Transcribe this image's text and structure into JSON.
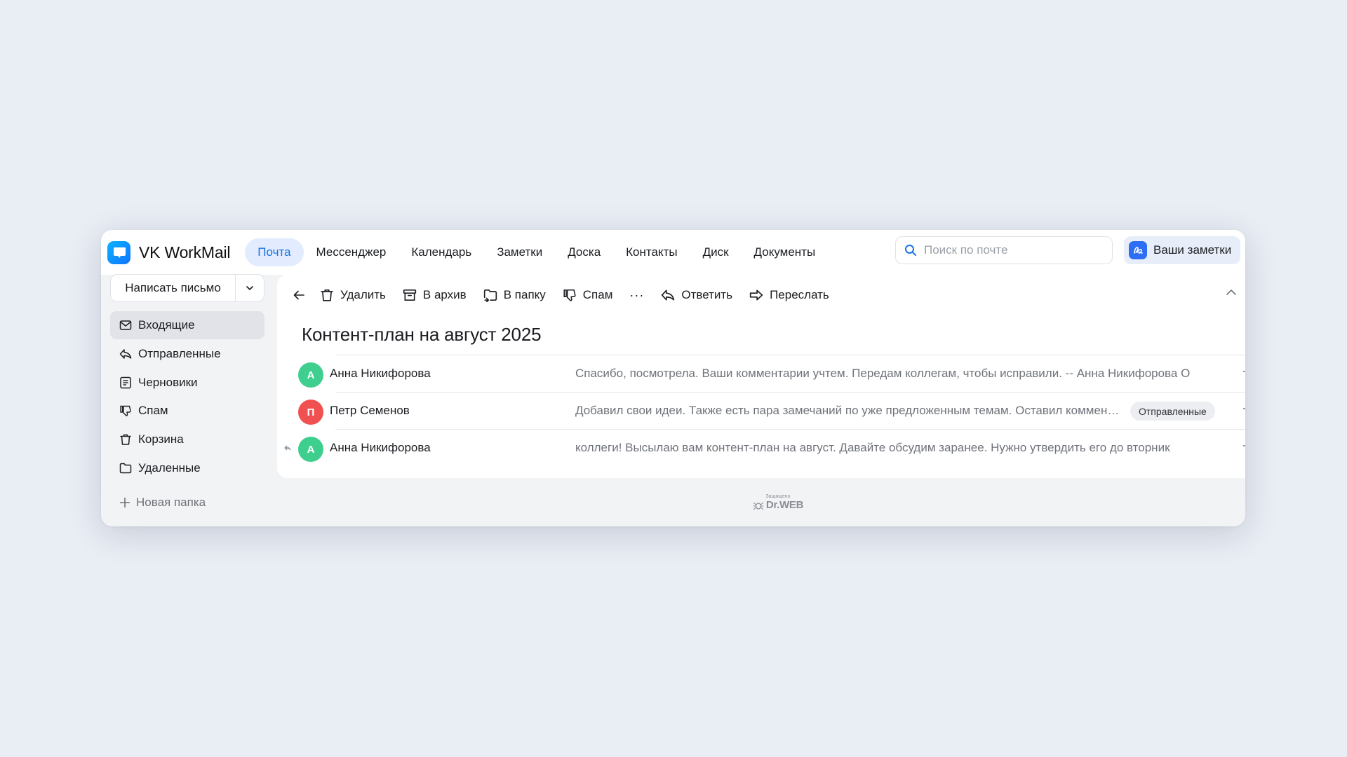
{
  "app": {
    "name": "VK WorkMail"
  },
  "nav": {
    "items": [
      {
        "label": "Почта",
        "active": true
      },
      {
        "label": "Мессенджер"
      },
      {
        "label": "Календарь"
      },
      {
        "label": "Заметки"
      },
      {
        "label": "Доска"
      },
      {
        "label": "Контакты"
      },
      {
        "label": "Диск"
      },
      {
        "label": "Документы"
      }
    ]
  },
  "search": {
    "placeholder": "Поиск по почте"
  },
  "notes_button": {
    "label": "Ваши заметки"
  },
  "sidebar": {
    "compose_label": "Написать письмо",
    "folders": [
      {
        "label": "Входящие",
        "icon": "inbox-icon",
        "active": true
      },
      {
        "label": "Отправленные",
        "icon": "sent-icon"
      },
      {
        "label": "Черновики",
        "icon": "drafts-icon"
      },
      {
        "label": "Спам",
        "icon": "spam-icon"
      },
      {
        "label": "Корзина",
        "icon": "trash-icon"
      },
      {
        "label": "Удаленные",
        "icon": "folder-icon"
      }
    ],
    "new_folder_label": "Новая папка"
  },
  "toolbar": {
    "delete": "Удалить",
    "archive": "В архив",
    "move": "В папку",
    "spam": "Спам",
    "reply": "Ответить",
    "forward": "Переслать"
  },
  "thread": {
    "subject": "Контент-план на август 2025",
    "messages": [
      {
        "initial": "А",
        "avatar_color": "#3ecf8e",
        "sender": "Анна Никифорова",
        "snippet": "Спасибо, посмотрела. Ваши комментарии учтем. Передам коллегам, чтобы исправили. -- Анна Никифорова О"
      },
      {
        "initial": "П",
        "avatar_color": "#f0504f",
        "sender": "Петр Семенов",
        "snippet": "Добавил свои идеи. Также есть пара замечаний по уже предложенным темам. Оставил коммента…",
        "tag": "Отправленные"
      },
      {
        "initial": "А",
        "avatar_color": "#3ecf8e",
        "sender": "Анна Никифорова",
        "snippet": "коллеги! Высылаю вам контент-план на август. Давайте обсудим заранее. Нужно утвердить его до вторник",
        "replied": true
      }
    ]
  },
  "footer": {
    "protected_label": "Защищено",
    "brand": "Dr.WEB"
  },
  "colors": {
    "accent": "#1a73e8",
    "nav_active_bg": "#e2ecfe",
    "page_bg": "#e9edf4"
  }
}
